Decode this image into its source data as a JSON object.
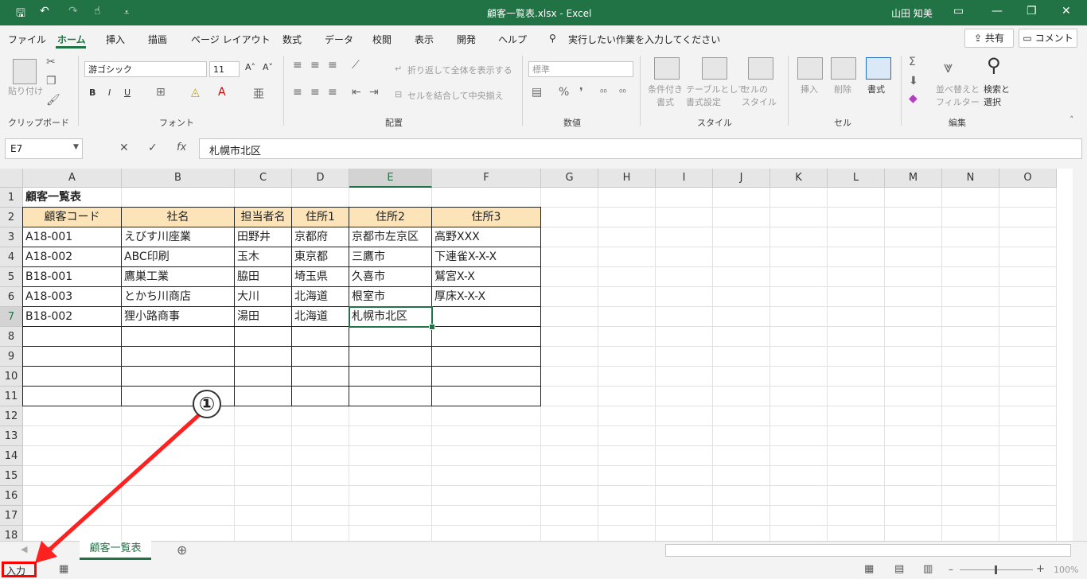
{
  "window": {
    "title": "顧客一覧表.xlsx  -  Excel",
    "user": "山田 知美"
  },
  "menu": [
    "ファイル",
    "ホーム",
    "挿入",
    "描画",
    "ページ レイアウト",
    "数式",
    "データ",
    "校閲",
    "表示",
    "開発",
    "ヘルプ"
  ],
  "search_placeholder": "実行したい作業を入力してください",
  "share_label": "共有",
  "comment_label": "コメント",
  "ribbon": {
    "groups": [
      "クリップボード",
      "フォント",
      "配置",
      "数値",
      "スタイル",
      "セル",
      "編集"
    ],
    "paste": "貼り付け",
    "font_name": "游ゴシック",
    "font_size": "11",
    "wrap_text": "折り返して全体を表示する",
    "merge_center": "セルを結合して中央揃え",
    "number_format": "標準",
    "cond_format": "条件付き\n書式",
    "table_format": "テーブルとして\n書式設定",
    "cell_style": "セルの\nスタイル",
    "insert": "挿入",
    "delete": "削除",
    "format": "書式",
    "sort_filter": "並べ替えと\nフィルター",
    "find_select": "検索と\n選択"
  },
  "namebox": "E7",
  "formula": "札幌市北区",
  "columns": [
    "A",
    "B",
    "C",
    "D",
    "E",
    "F",
    "G",
    "H",
    "I",
    "J",
    "K",
    "L",
    "M",
    "N",
    "O"
  ],
  "rows": [
    "1",
    "2",
    "3",
    "4",
    "5",
    "6",
    "7",
    "8",
    "9",
    "10",
    "11",
    "12",
    "13",
    "14",
    "15",
    "16",
    "17",
    "18"
  ],
  "sheet": {
    "title": "顧客一覧表",
    "headers": [
      "顧客コード",
      "社名",
      "担当者名",
      "住所1",
      "住所2",
      "住所3"
    ],
    "data": [
      [
        "A18-001",
        "えびす川座業",
        "田野井",
        "京都府",
        "京都市左京区",
        "高野XXX"
      ],
      [
        "A18-002",
        "ABC印刷",
        "玉木",
        "東京都",
        "三鷹市",
        "下連雀X-X-X"
      ],
      [
        "B18-001",
        "鷹巣工業",
        "脇田",
        "埼玉県",
        "久喜市",
        "鷲宮X-X"
      ],
      [
        "A18-003",
        "とかち川商店",
        "大川",
        "北海道",
        "根室市",
        "厚床X-X-X"
      ],
      [
        "B18-002",
        "狸小路商事",
        "湯田",
        "北海道",
        "札幌市北区",
        ""
      ]
    ]
  },
  "sheet_tab": "顧客一覧表",
  "status": {
    "mode": "入力",
    "zoom": "100%"
  },
  "annotation": {
    "number": "①"
  }
}
